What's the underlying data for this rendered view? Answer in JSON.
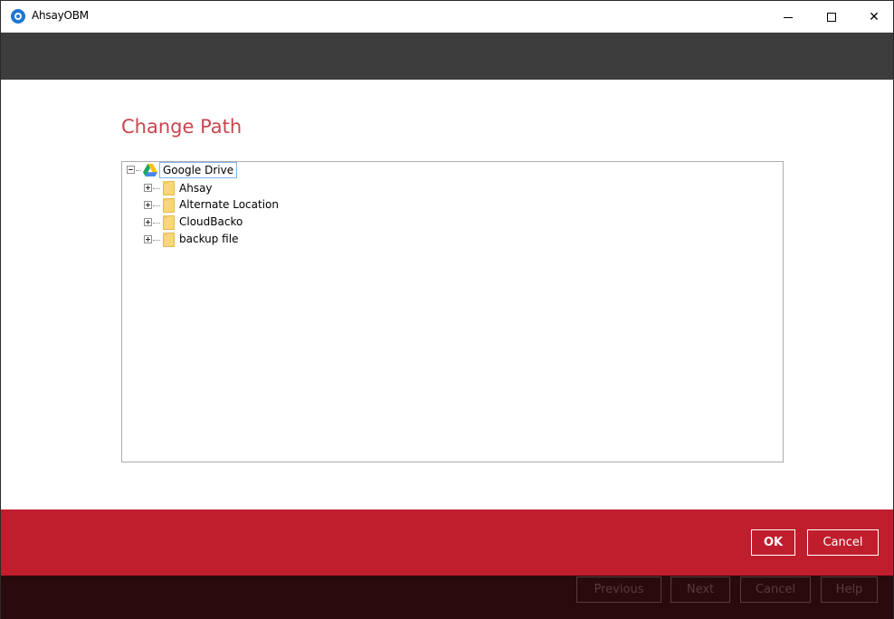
{
  "window": {
    "title": "AhsayOBM",
    "controls": {
      "minimize": "minimize",
      "maximize": "maximize",
      "close": "✕"
    }
  },
  "page": {
    "title": "Change Path"
  },
  "tree": {
    "root": {
      "label": "Google Drive",
      "icon": "google-drive-icon",
      "expanded": true
    },
    "children": [
      {
        "label": "Ahsay",
        "icon": "folder-icon",
        "expanded": false
      },
      {
        "label": "Alternate Location",
        "icon": "folder-icon",
        "expanded": false
      },
      {
        "label": "CloudBacko",
        "icon": "folder-icon",
        "expanded": false
      },
      {
        "label": "backup file",
        "icon": "folder-icon",
        "expanded": false
      }
    ]
  },
  "actions": {
    "ok_label": "OK",
    "cancel_label": "Cancel"
  },
  "footer": {
    "previous_label": "Previous",
    "next_label": "Next",
    "cancel_label": "Cancel",
    "help_label": "Help"
  },
  "colors": {
    "title_accent": "#c9454f",
    "action_bar": "#c01e2d",
    "header_bar": "#3d3d3d",
    "footer_bar": "#2b0a0e",
    "app_icon": "#1d77d2"
  }
}
